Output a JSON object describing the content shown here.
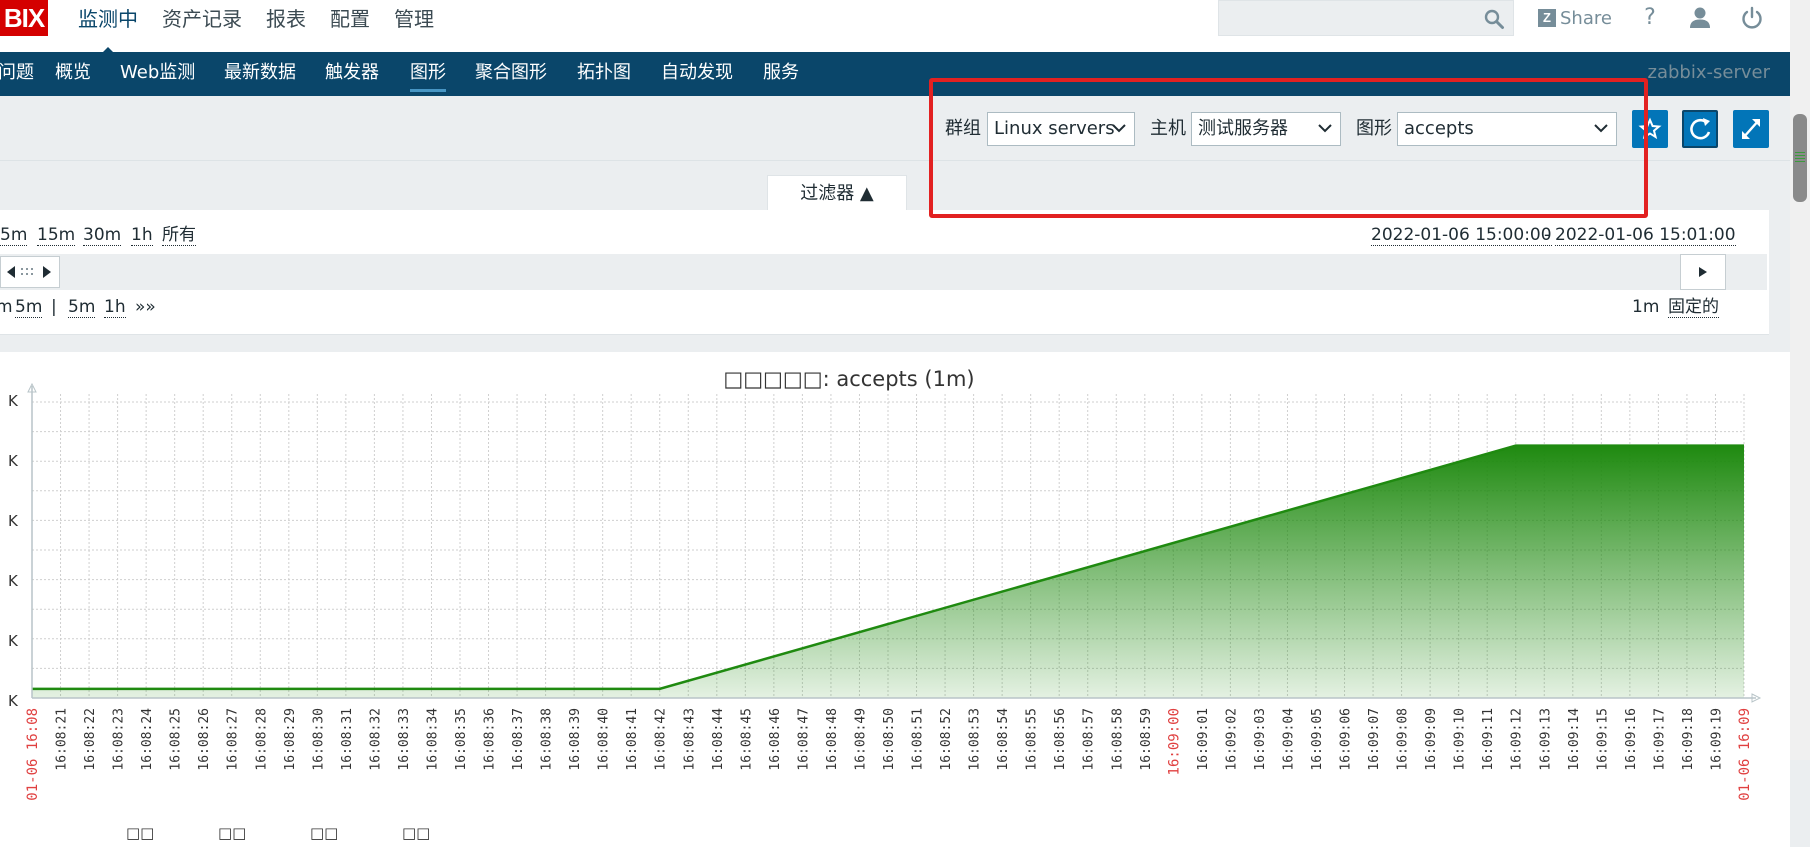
{
  "logo": {
    "text": "BIX",
    "color": "#d40000"
  },
  "top_nav": [
    {
      "label": "监测中",
      "active": true
    },
    {
      "label": "资产记录",
      "active": false
    },
    {
      "label": "报表",
      "active": false
    },
    {
      "label": "配置",
      "active": false
    },
    {
      "label": "管理",
      "active": false
    }
  ],
  "search": {
    "placeholder": "",
    "icon": "search-icon"
  },
  "share": {
    "icon_letter": "Z",
    "label": "Share"
  },
  "top_icons": {
    "help": "?",
    "user": "user-icon",
    "power": "power-icon"
  },
  "sub_nav": {
    "items": [
      "问题",
      "概览",
      "Web监测",
      "最新数据",
      "触发器",
      "图形",
      "聚合图形",
      "拓扑图",
      "自动发现",
      "服务"
    ],
    "active_index": 5,
    "server_name": "zabbix-server"
  },
  "filters": {
    "group": {
      "label": "群组",
      "value": "Linux servers"
    },
    "host": {
      "label": "主机",
      "value": "测试服务器"
    },
    "graph": {
      "label": "图形",
      "value": "accepts"
    }
  },
  "filter_tab": {
    "label": "过滤器 ▲"
  },
  "time_filter": {
    "quick": [
      "5m",
      "15m",
      "30m",
      "1h",
      "所有"
    ],
    "range_from": "2022-01-06 15:00:00",
    "range_sep": "-",
    "range_to": "2022-01-06 15:01:00",
    "zoom_left": [
      "m",
      "5m"
    ],
    "zoom_sep": "|",
    "zoom_right": [
      "5m",
      "1h"
    ],
    "zoom_more": "»»",
    "period_value": "1m",
    "fixed_label": "固定的"
  },
  "chart_data": {
    "type": "area",
    "title": "□□□□□: accepts (1m)",
    "y_tick_labels": [
      "K",
      "K",
      "K",
      "K",
      "K",
      "K"
    ],
    "x_labels": [
      "01-06 16:08",
      "16:08:21",
      "16:08:22",
      "16:08:23",
      "16:08:24",
      "16:08:25",
      "16:08:26",
      "16:08:27",
      "16:08:28",
      "16:08:29",
      "16:08:30",
      "16:08:31",
      "16:08:32",
      "16:08:33",
      "16:08:34",
      "16:08:35",
      "16:08:36",
      "16:08:37",
      "16:08:38",
      "16:08:39",
      "16:08:40",
      "16:08:41",
      "16:08:42",
      "16:08:43",
      "16:08:44",
      "16:08:45",
      "16:08:46",
      "16:08:47",
      "16:08:48",
      "16:08:49",
      "16:08:50",
      "16:08:51",
      "16:08:52",
      "16:08:53",
      "16:08:54",
      "16:08:55",
      "16:08:56",
      "16:08:57",
      "16:08:58",
      "16:08:59",
      "16:09:00",
      "16:09:01",
      "16:09:02",
      "16:09:03",
      "16:09:04",
      "16:09:05",
      "16:09:06",
      "16:09:07",
      "16:09:08",
      "16:09:09",
      "16:09:10",
      "16:09:11",
      "16:09:12",
      "16:09:13",
      "16:09:14",
      "16:09:15",
      "16:09:16",
      "16:09:17",
      "16:09:18",
      "16:09:19",
      "01-06 16:09"
    ],
    "highlight_labels": [
      0,
      40,
      60
    ],
    "series": [
      {
        "points": [
          [
            0,
            0.03
          ],
          [
            22,
            0.03
          ],
          [
            52,
            0.83
          ],
          [
            60,
            0.83
          ]
        ]
      }
    ],
    "y_range": [
      0,
      1
    ],
    "grid": true,
    "series_color": "#1f8a10",
    "legend_fragments": [
      "□□",
      "□□",
      "□□",
      "□□"
    ]
  },
  "annotation": {
    "color": "#e22121"
  },
  "colors": {
    "nav_dark": "#0a466a",
    "accent": "#0275b8",
    "highlight_red": "#e04040"
  }
}
